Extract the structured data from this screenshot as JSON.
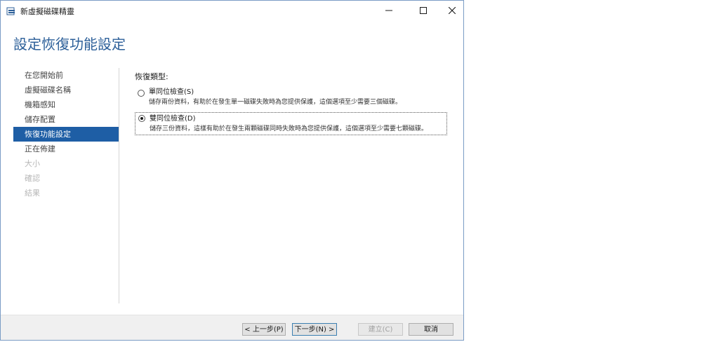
{
  "window": {
    "title": "新虛擬磁碟精靈"
  },
  "page": {
    "title": "設定恢復功能設定"
  },
  "sidebar": {
    "items": [
      {
        "label": "在您開始前"
      },
      {
        "label": "虛擬磁碟名稱"
      },
      {
        "label": "機箱感知"
      },
      {
        "label": "儲存配置"
      },
      {
        "label": "恢復功能設定"
      },
      {
        "label": "正在佈建"
      },
      {
        "label": "大小"
      },
      {
        "label": "確認"
      },
      {
        "label": "結果"
      }
    ]
  },
  "resiliency": {
    "label": "恢復類型:",
    "options": [
      {
        "title": "單同位檢查(S)",
        "description": "儲存兩份資料，有助於在發生單一磁碟失敗時為您提供保護，這個選項至少需要三個磁碟。"
      },
      {
        "title": "雙同位檢查(D)",
        "description": "儲存三份資料，這樣有助於在發生兩顆磁碟同時失敗時為您提供保護，這個選項至少需要七顆磁碟。"
      }
    ]
  },
  "footer": {
    "prev": "< 上一步(P)",
    "next": "下一步(N) >",
    "create": "建立(C)",
    "cancel": "取消"
  },
  "colors": {
    "accent": "#1e5ea5",
    "title": "#2c5f99"
  }
}
